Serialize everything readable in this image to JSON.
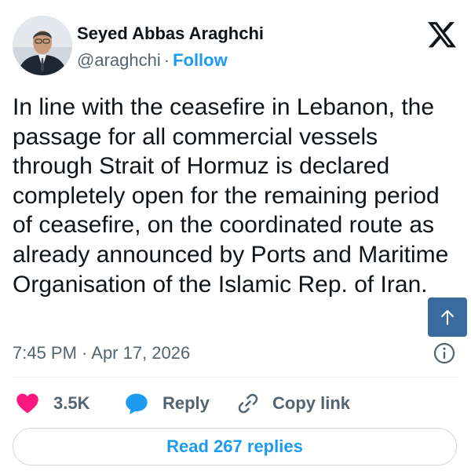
{
  "author": {
    "name": "Seyed Abbas Araghchi",
    "handle": "@araghchi",
    "separator": "·",
    "follow_label": "Follow"
  },
  "tweet": {
    "text": "In line with the ceasefire in Lebanon, the passage for all commercial vessels through Strait of Hormuz is declared completely open for the remaining period of ceasefire, on the coordinated route as already announced by Ports and Maritime Organisation of the Islamic Rep. of Iran.",
    "timestamp": "7:45 PM · Apr 17, 2026"
  },
  "actions": {
    "likes_count": "3.5K",
    "reply_label": "Reply",
    "copy_link_label": "Copy link"
  },
  "footer": {
    "read_replies_label": "Read 267 replies"
  },
  "icons": {
    "platform": "x-logo-icon",
    "like": "heart-icon",
    "reply": "speech-bubble-icon",
    "copy": "link-icon",
    "info": "info-icon",
    "scroll": "arrow-up-icon"
  },
  "colors": {
    "accent": "#1d9bf0",
    "like": "#f91880",
    "secondary_text": "#536471",
    "scroll_button": "#3b6a9c"
  }
}
